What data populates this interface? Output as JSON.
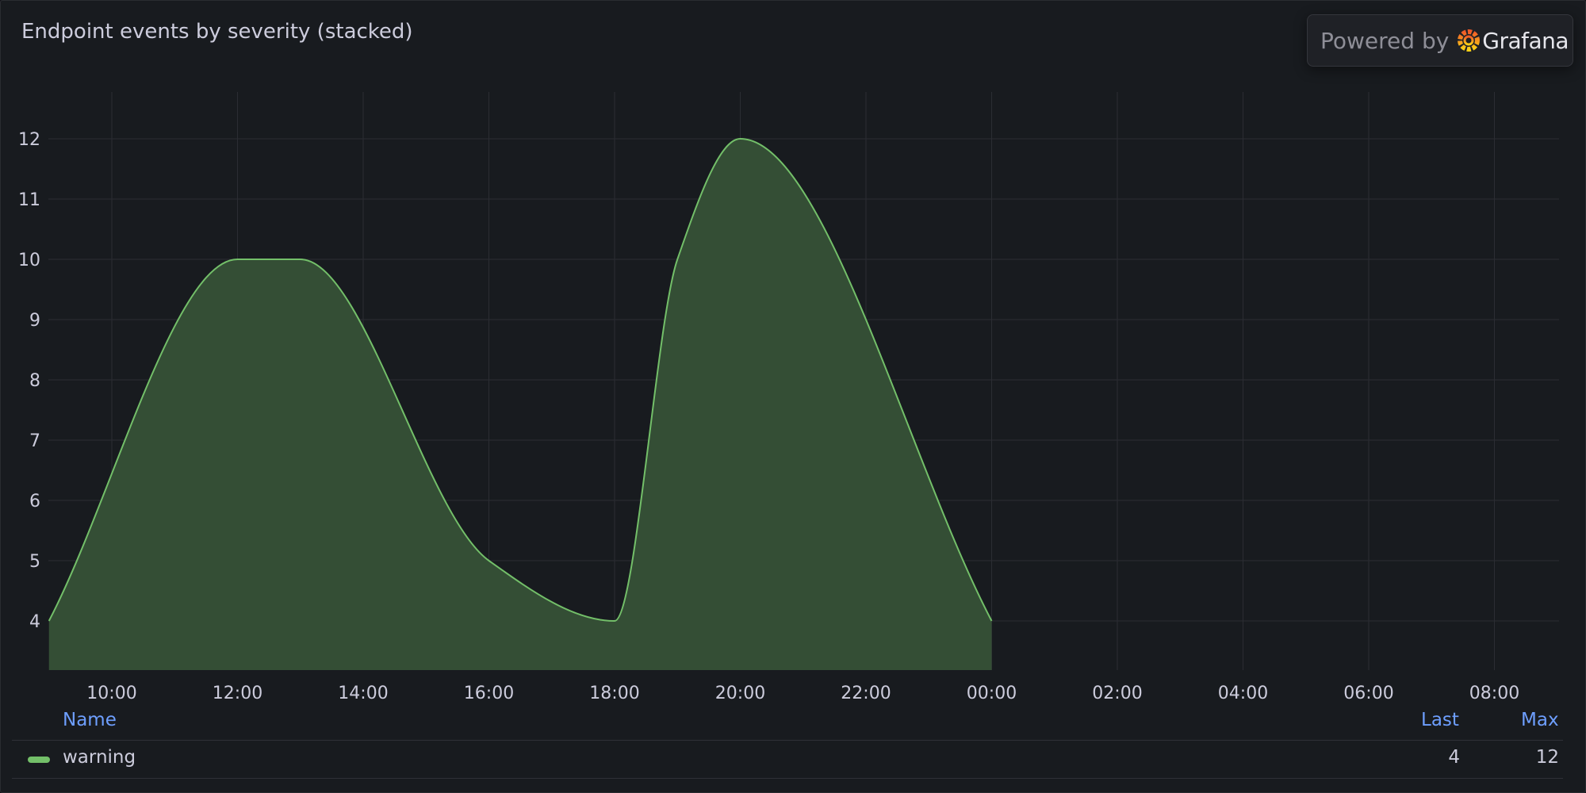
{
  "panel": {
    "title": "Endpoint events by severity (stacked)",
    "powered_by": "Powered by",
    "brand": "Grafana"
  },
  "colors": {
    "series": "#73bf69",
    "fill": "#344e35",
    "grid": "#2b2d33",
    "legend_header": "#6e9fff"
  },
  "chart_data": {
    "type": "area",
    "title": "Endpoint events by severity (stacked)",
    "xlabel": "",
    "ylabel": "",
    "x_ticks": [
      "10:00",
      "12:00",
      "14:00",
      "16:00",
      "18:00",
      "20:00",
      "22:00",
      "00:00",
      "02:00",
      "04:00",
      "06:00",
      "08:00"
    ],
    "y_ticks": [
      4,
      5,
      6,
      7,
      8,
      9,
      10,
      11,
      12
    ],
    "grid": true,
    "series": [
      {
        "name": "warning",
        "color": "#73bf69",
        "points": [
          {
            "t": "09:00",
            "v": 4
          },
          {
            "t": "12:00",
            "v": 10
          },
          {
            "t": "13:00",
            "v": 10
          },
          {
            "t": "16:00",
            "v": 5
          },
          {
            "t": "18:00",
            "v": 4
          },
          {
            "t": "19:00",
            "v": 10
          },
          {
            "t": "20:00",
            "v": 12
          },
          {
            "t": "00:00",
            "v": 4
          }
        ]
      }
    ]
  },
  "legend": {
    "headers": {
      "name": "Name",
      "last": "Last",
      "max": "Max"
    },
    "rows": [
      {
        "name": "warning",
        "last": "4",
        "max": "12"
      }
    ]
  }
}
